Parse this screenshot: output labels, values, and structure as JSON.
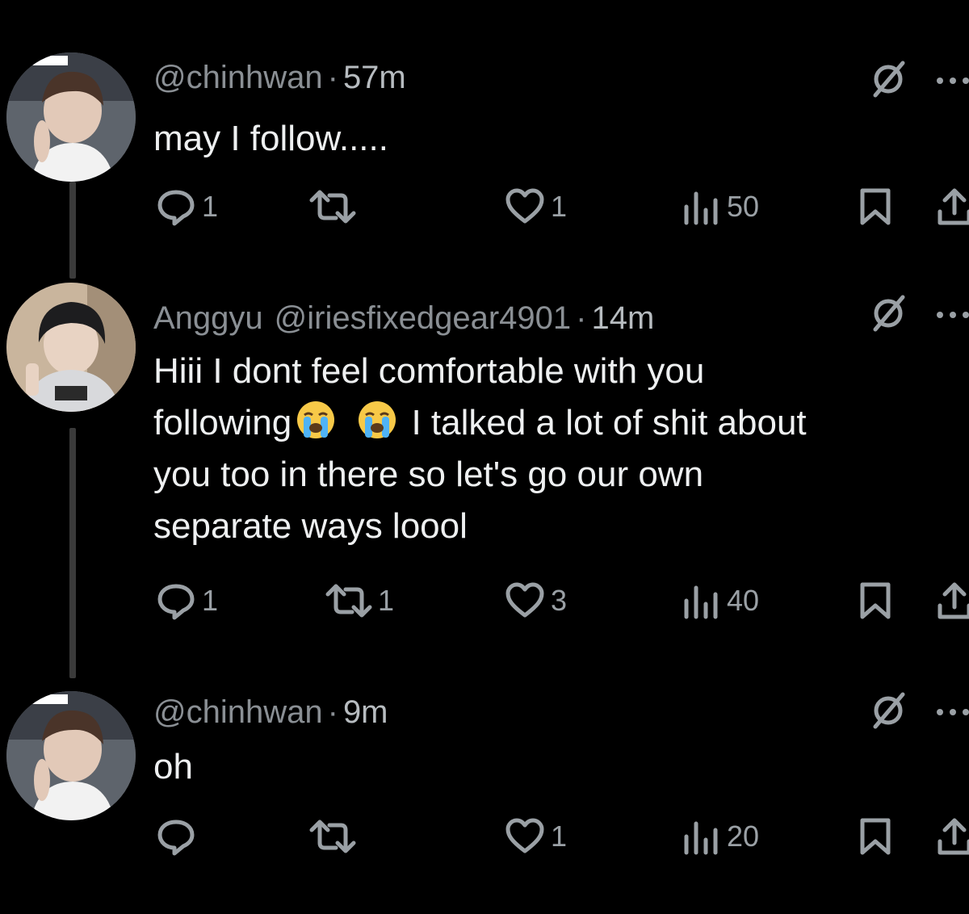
{
  "thread": [
    {
      "display_name": "",
      "handle": "@chinhwan",
      "separator": "·",
      "time": "57m",
      "lines": [
        "may I follow....."
      ],
      "actions": {
        "replies": "1",
        "reposts": "",
        "likes": "1",
        "views": "50"
      },
      "avatar_icon": "avatar-photo-icon"
    },
    {
      "display_name": "Anggyu",
      "handle": "@iriesfixedgear4901",
      "separator": "·",
      "time": "14m",
      "lines": [
        "Hiii I dont feel comfortable with you",
        [
          "following",
          "loudly-crying-emoji",
          "loudly-crying-emoji",
          " I talked a lot of shit about"
        ],
        "you too in there so let's go our own",
        "separate ways loool"
      ],
      "line2_parts": {
        "before": "following",
        "after": "I talked a lot of shit about"
      },
      "actions": {
        "replies": "1",
        "reposts": "1",
        "likes": "3",
        "views": "40"
      },
      "avatar_icon": "avatar-photo-icon"
    },
    {
      "display_name": "",
      "handle": "@chinhwan",
      "separator": "·",
      "time": "9m",
      "lines": [
        "oh"
      ],
      "actions": {
        "replies": "",
        "reposts": "",
        "likes": "1",
        "views": "20"
      },
      "avatar_icon": "avatar-photo-icon"
    }
  ],
  "icons": {
    "meta": [
      "hidden-icon",
      "more-icon"
    ],
    "actions": [
      "reply-icon",
      "repost-icon",
      "like-icon",
      "views-icon",
      "bookmark-icon",
      "share-icon"
    ]
  },
  "colors": {
    "background": "#000000",
    "text": "#eef0f1",
    "muted": "#8a8f94",
    "thread_line": "#3a3a3a"
  }
}
